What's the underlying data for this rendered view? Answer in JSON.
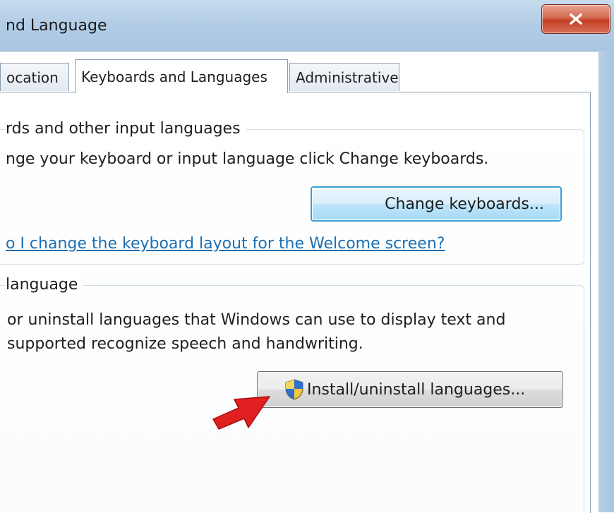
{
  "window": {
    "title": "nd Language",
    "close_icon": "close-icon"
  },
  "tabs": [
    {
      "label": "Location",
      "shown_text": "ocation",
      "selected": false
    },
    {
      "label": "Keyboards and Languages",
      "selected": true
    },
    {
      "label": "Administrative",
      "selected": false
    }
  ],
  "keyboards_group": {
    "title": "rds and other input languages",
    "description": "nge your keyboard or input language click Change keyboards.",
    "button_label": "Change keyboards...",
    "link_text": "o I change the keyboard layout for the Welcome screen?"
  },
  "display_group": {
    "title": "language",
    "description_line1": "or uninstall languages that Windows can use to display text and",
    "description_line2": "supported recognize speech and handwriting.",
    "button_label": "Install/uninstall languages...",
    "button_icon": "uac-shield-icon"
  },
  "annotation": {
    "icon": "red-arrow-icon",
    "color": "#e02020"
  },
  "colors": {
    "link": "#1c6fb2",
    "focused_button_border": "#3c9fd8",
    "title_bar": "#b3cde6",
    "close_button": "#c33f23"
  }
}
